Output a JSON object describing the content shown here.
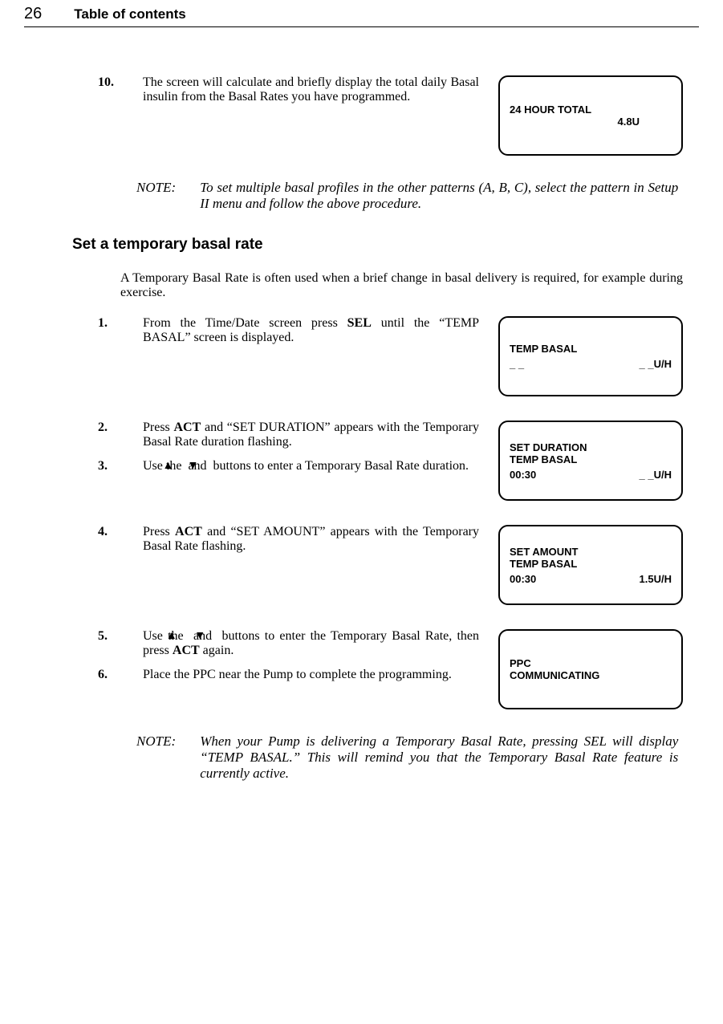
{
  "header": {
    "page_number": "26",
    "title": "Table of contents"
  },
  "step10": {
    "num": "10.",
    "text_before": "The screen will calculate and briefly display the total daily Basal insulin from the Basal Rates you have programmed."
  },
  "screen_24h": {
    "line1": "24 HOUR TOTAL",
    "value": "4.8U"
  },
  "note1": {
    "label": "NOTE:",
    "text": "To set multiple basal profiles in the other patterns (A, B, C), select the pattern in Setup II menu and follow the above procedure."
  },
  "section_title": "Set a temporary basal rate",
  "intro": "A Temporary Basal Rate is often used when a brief change in basal delivery is required, for example during exercise.",
  "steps": {
    "s1": {
      "num": "1.",
      "before": "From the Time/Date screen press ",
      "bold1": "SEL",
      "after": " until the “TEMP BASAL” screen is displayed."
    },
    "s2": {
      "num": "2.",
      "before": "Press ",
      "bold1": "ACT",
      "after": " and “SET DURATION” appears with the Temporary Basal Rate duration flashing."
    },
    "s3": {
      "num": "3.",
      "before": "Use the ",
      "mid": " and ",
      "after": " buttons to enter a Temporary Basal Rate duration."
    },
    "s4": {
      "num": "4.",
      "before": "Press ",
      "bold1": "ACT",
      "after": " and “SET AMOUNT” appears with the Temporary Basal Rate flashing."
    },
    "s5": {
      "num": "5.",
      "before": "Use the ",
      "mid": " and ",
      "after1": " buttons to enter the Temporary Basal Rate, then press ",
      "bold1": "ACT",
      "after2": " again."
    },
    "s6": {
      "num": "6.",
      "text": "Place the PPC near the Pump to complete the programming."
    }
  },
  "screen_temp": {
    "line1": "TEMP BASAL",
    "left": "_ _",
    "right": "_ _U/H"
  },
  "screen_dur": {
    "line1": "SET DURATION",
    "line2": "TEMP BASAL",
    "left": "00:30",
    "right": "_ _U/H"
  },
  "screen_amt": {
    "line1": "SET AMOUNT",
    "line2": "TEMP BASAL",
    "left": "00:30",
    "right": "1.5U/H"
  },
  "screen_ppc": {
    "line1": "PPC",
    "line2": "COMMUNICATING"
  },
  "note2": {
    "label": "NOTE:",
    "text": "When your Pump is delivering a Temporary Basal Rate, pressing SEL will display “TEMP BASAL.” This will remind you that the Temporary Basal Rate feature is currently active."
  }
}
